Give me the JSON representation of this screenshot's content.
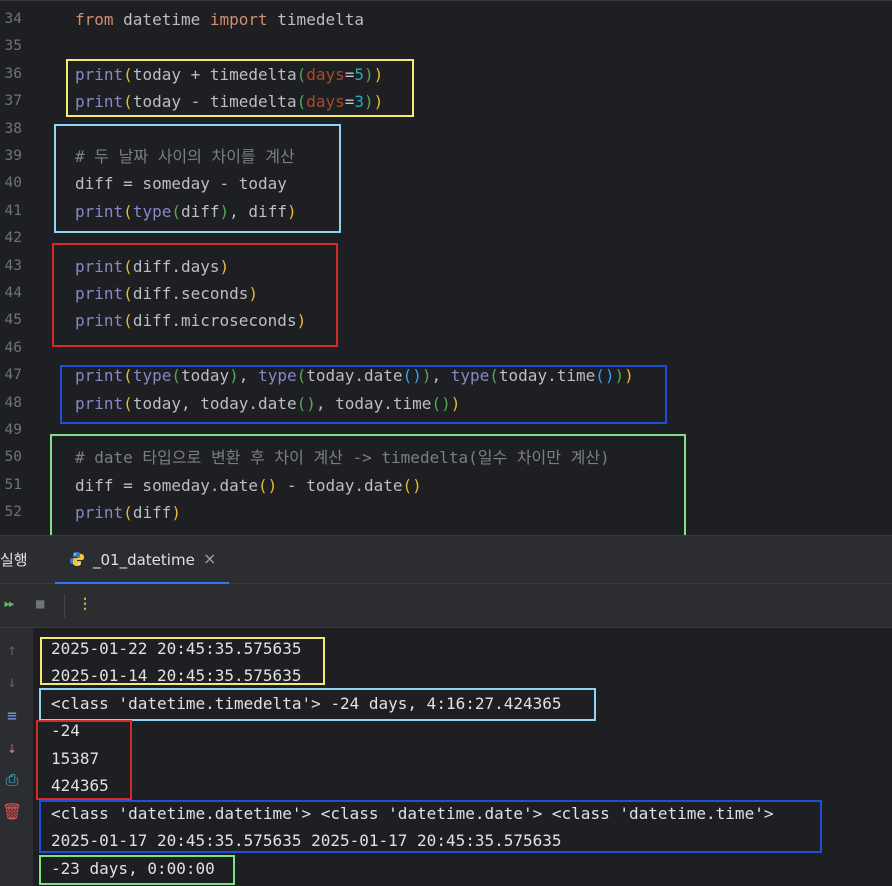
{
  "editor": {
    "lines": [
      {
        "num": "34",
        "tokens": [
          {
            "t": "from",
            "c": "kw"
          },
          {
            "t": " datetime ",
            "c": "pl"
          },
          {
            "t": "import",
            "c": "kw"
          },
          {
            "t": " timedelta",
            "c": "pl"
          }
        ]
      },
      {
        "num": "35",
        "tokens": []
      },
      {
        "num": "36",
        "tokens": [
          {
            "t": "print",
            "c": "bi"
          },
          {
            "t": "(",
            "c": "p1"
          },
          {
            "t": "today + ",
            "c": "pl"
          },
          {
            "t": "timedelta",
            "c": "pl"
          },
          {
            "t": "(",
            "c": "p2"
          },
          {
            "t": "days",
            "c": "pr"
          },
          {
            "t": "=",
            "c": "pl"
          },
          {
            "t": "5",
            "c": "nm"
          },
          {
            "t": ")",
            "c": "p2"
          },
          {
            "t": ")",
            "c": "p1"
          }
        ]
      },
      {
        "num": "37",
        "tokens": [
          {
            "t": "print",
            "c": "bi"
          },
          {
            "t": "(",
            "c": "p1"
          },
          {
            "t": "today - ",
            "c": "pl"
          },
          {
            "t": "timedelta",
            "c": "pl"
          },
          {
            "t": "(",
            "c": "p2"
          },
          {
            "t": "days",
            "c": "pr"
          },
          {
            "t": "=",
            "c": "pl"
          },
          {
            "t": "3",
            "c": "nm"
          },
          {
            "t": ")",
            "c": "p2"
          },
          {
            "t": ")",
            "c": "p1"
          }
        ]
      },
      {
        "num": "38",
        "tokens": []
      },
      {
        "num": "39",
        "tokens": [
          {
            "t": "# 두 날짜 사이의 차이를 계산",
            "c": "cm"
          }
        ]
      },
      {
        "num": "40",
        "tokens": [
          {
            "t": "diff = someday - today",
            "c": "pl"
          }
        ]
      },
      {
        "num": "41",
        "tokens": [
          {
            "t": "print",
            "c": "bi"
          },
          {
            "t": "(",
            "c": "p1"
          },
          {
            "t": "type",
            "c": "bi"
          },
          {
            "t": "(",
            "c": "p2"
          },
          {
            "t": "diff",
            "c": "pl"
          },
          {
            "t": ")",
            "c": "p2"
          },
          {
            "t": ", diff",
            "c": "pl"
          },
          {
            "t": ")",
            "c": "p1"
          }
        ]
      },
      {
        "num": "42",
        "tokens": []
      },
      {
        "num": "43",
        "tokens": [
          {
            "t": "print",
            "c": "bi"
          },
          {
            "t": "(",
            "c": "p1"
          },
          {
            "t": "diff.days",
            "c": "pl"
          },
          {
            "t": ")",
            "c": "p1"
          }
        ]
      },
      {
        "num": "44",
        "tokens": [
          {
            "t": "print",
            "c": "bi"
          },
          {
            "t": "(",
            "c": "p1"
          },
          {
            "t": "diff.seconds",
            "c": "pl"
          },
          {
            "t": ")",
            "c": "p1"
          }
        ]
      },
      {
        "num": "45",
        "tokens": [
          {
            "t": "print",
            "c": "bi"
          },
          {
            "t": "(",
            "c": "p1"
          },
          {
            "t": "diff.microseconds",
            "c": "pl"
          },
          {
            "t": ")",
            "c": "p1"
          }
        ]
      },
      {
        "num": "46",
        "tokens": []
      },
      {
        "num": "47",
        "tokens": [
          {
            "t": "print",
            "c": "bi"
          },
          {
            "t": "(",
            "c": "p1"
          },
          {
            "t": "type",
            "c": "bi"
          },
          {
            "t": "(",
            "c": "p2"
          },
          {
            "t": "today",
            "c": "pl"
          },
          {
            "t": ")",
            "c": "p2"
          },
          {
            "t": ", ",
            "c": "pl"
          },
          {
            "t": "type",
            "c": "bi"
          },
          {
            "t": "(",
            "c": "p2"
          },
          {
            "t": "today.date",
            "c": "pl"
          },
          {
            "t": "()",
            "c": "p3"
          },
          {
            "t": ")",
            "c": "p2"
          },
          {
            "t": ", ",
            "c": "pl"
          },
          {
            "t": "type",
            "c": "bi"
          },
          {
            "t": "(",
            "c": "p2"
          },
          {
            "t": "today.time",
            "c": "pl"
          },
          {
            "t": "()",
            "c": "p3"
          },
          {
            "t": ")",
            "c": "p2"
          },
          {
            "t": ")",
            "c": "p1"
          }
        ]
      },
      {
        "num": "48",
        "tokens": [
          {
            "t": "print",
            "c": "bi"
          },
          {
            "t": "(",
            "c": "p1"
          },
          {
            "t": "today, today.date",
            "c": "pl"
          },
          {
            "t": "()",
            "c": "p2"
          },
          {
            "t": ", today.time",
            "c": "pl"
          },
          {
            "t": "()",
            "c": "p2"
          },
          {
            "t": ")",
            "c": "p1"
          }
        ]
      },
      {
        "num": "49",
        "tokens": []
      },
      {
        "num": "50",
        "tokens": [
          {
            "t": "# date 타입으로 변환 후 차이 계산 -> timedelta(일수 차이만 계산)",
            "c": "cm"
          }
        ]
      },
      {
        "num": "51",
        "tokens": [
          {
            "t": "diff = someday.date",
            "c": "pl"
          },
          {
            "t": "()",
            "c": "p1"
          },
          {
            "t": " - today.date",
            "c": "pl"
          },
          {
            "t": "()",
            "c": "p1"
          }
        ]
      },
      {
        "num": "52",
        "tokens": [
          {
            "t": "print",
            "c": "bi"
          },
          {
            "t": "(",
            "c": "p1"
          },
          {
            "t": "diff",
            "c": "pl"
          },
          {
            "t": ")",
            "c": "p1"
          }
        ]
      }
    ]
  },
  "run_panel": {
    "title": "실행",
    "tab_name": "_01_datetime",
    "close_glyph": "×"
  },
  "toolbar": {
    "rerun_icon": "▸▸",
    "stop_icon": "■",
    "more_icon": "⋮"
  },
  "console": {
    "output": [
      "2025-01-22 20:45:35.575635",
      "2025-01-14 20:45:35.575635",
      "<class 'datetime.timedelta'> -24 days, 4:16:27.424365",
      "-24",
      "15387",
      "424365",
      "<class 'datetime.datetime'> <class 'datetime.date'> <class 'datetime.time'>",
      "2025-01-17 20:45:35.575635 2025-01-17 20:45:35.575635",
      "-23 days, 0:00:00"
    ]
  },
  "colors": {
    "yellow_box": "#f5e96e",
    "lightblue_box": "#8fd3f5",
    "red_box": "#d42a2a",
    "blue_box": "#1f4fd6",
    "green_box": "#7fe27f"
  }
}
